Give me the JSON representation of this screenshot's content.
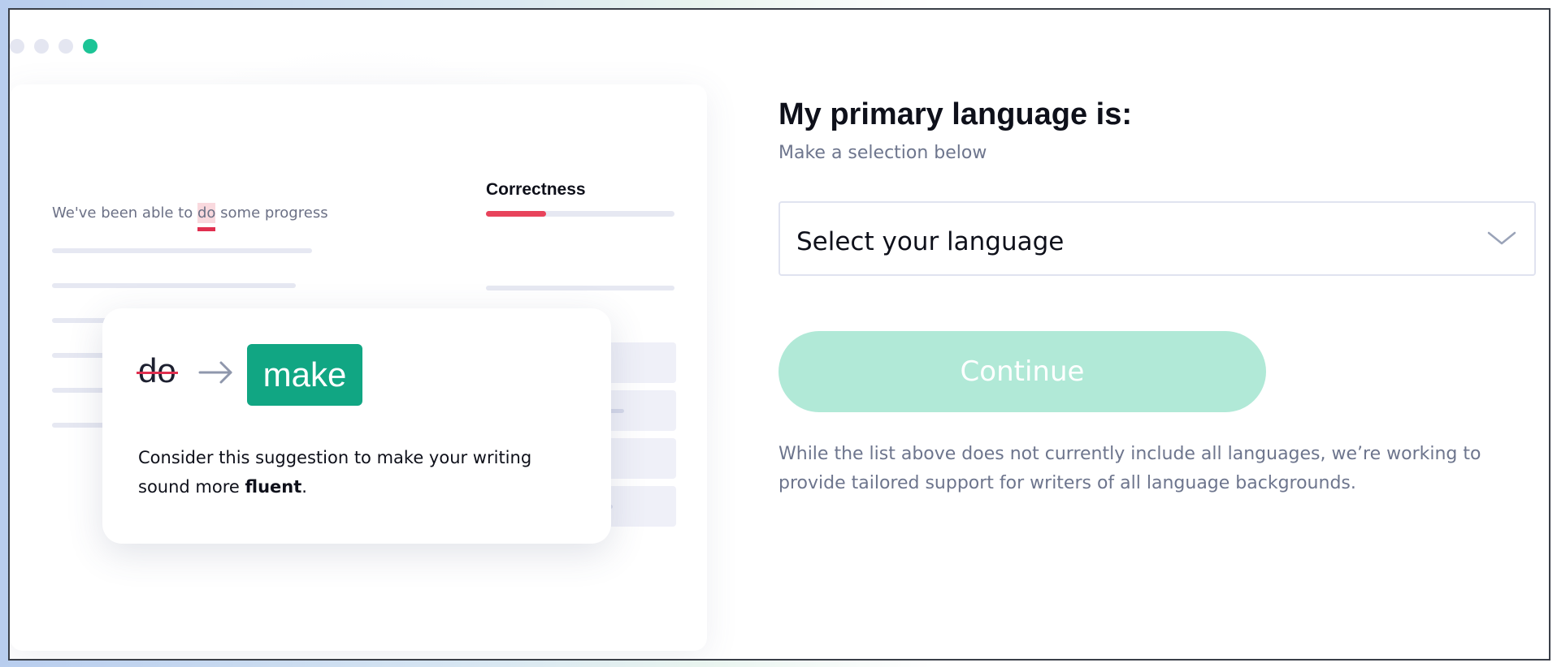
{
  "colors": {
    "accent": "#11a683",
    "continue_disabled": "#b1e9d7",
    "error_red": "#e02f4f",
    "window_dot_active": "#1cc496",
    "window_dot_inactive": "#e4e6f1"
  },
  "window_controls": [
    "inactive",
    "inactive",
    "inactive",
    "active"
  ],
  "illustration": {
    "sample_sentence": {
      "before": "We've been able to ",
      "highlight": "do",
      "after": " some progress"
    },
    "correctness_label": "Correctness",
    "correctness_progress": 0.32,
    "suggestion": {
      "original": "do",
      "replacement": "make",
      "arrow_icon": "arrow-right-icon",
      "message_prefix": "Consider this suggestion to make your writing sound more ",
      "message_bold": "fluent",
      "message_suffix": "."
    }
  },
  "form": {
    "heading": "My primary language is:",
    "subheading": "Make a selection below",
    "language_select": {
      "placeholder": "Select your language",
      "icon": "chevron-down-icon"
    },
    "continue_label": "Continue",
    "note": "While the list above does not currently include all languages, we’re working to provide tailored support for writers of all language backgrounds."
  }
}
